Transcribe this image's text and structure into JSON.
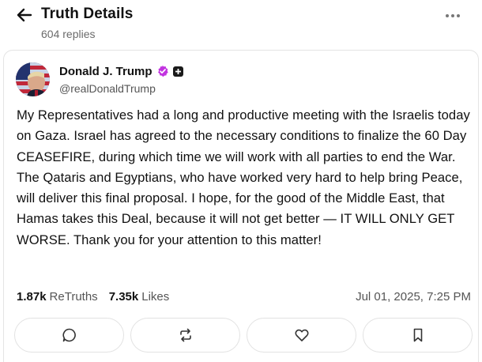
{
  "header": {
    "title": "Truth Details",
    "replies": "604 replies"
  },
  "post": {
    "author": {
      "name": "Donald J. Trump",
      "handle": "@realDonaldTrump"
    },
    "text": "My Representatives had a long and productive meeting with the Israelis today on Gaza. Israel has agreed to the necessary conditions to finalize the 60 Day CEASEFIRE, during which time we will work with all parties to end the War. The Qataris and Egyptians, who have worked very hard to help bring Peace, will deliver this final proposal. I hope, for the good of the Middle East, that Hamas takes this Deal, because it will not get better — IT WILL ONLY GET WORSE. Thank you for your attention to this matter!",
    "stats": {
      "retruths_count": "1.87k",
      "retruths_label": "ReTruths",
      "likes_count": "7.35k",
      "likes_label": "Likes"
    },
    "timestamp": "Jul 01, 2025, 7:25 PM"
  },
  "icons": {
    "back": "arrow-left-icon",
    "more": "more-horizontal-icon",
    "verified": "verified-badge-icon",
    "reply": "reply-icon",
    "retruth": "retruth-icon",
    "like": "heart-icon",
    "bookmark": "bookmark-icon"
  },
  "colors": {
    "verified": "#c233e0",
    "text": "#111111",
    "muted": "#555555",
    "border": "#e2e2e2"
  }
}
